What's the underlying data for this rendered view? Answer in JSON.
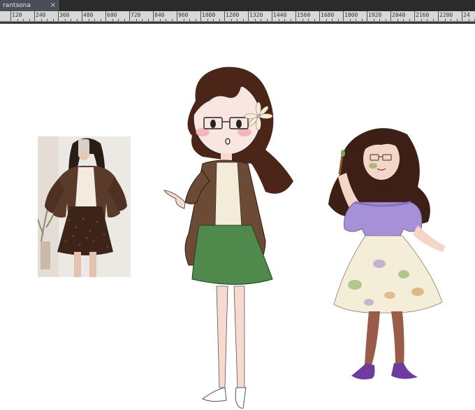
{
  "document_tab": {
    "title": "rantsona",
    "close_glyph": "×"
  },
  "ruler": {
    "labels": [
      "120",
      "240",
      "360",
      "480",
      "600",
      "720",
      "840",
      "960",
      "1080",
      "1200",
      "1320",
      "1440",
      "1560",
      "1680",
      "1800",
      "1920",
      "2040",
      "2160",
      "2280",
      "24"
    ]
  },
  "canvas": {
    "reference_photo": {
      "subject": "reference-outfit-photo",
      "colors": {
        "cardigan": "#5a3a28",
        "blouse": "#f2ece0",
        "skirt": "#3d2418",
        "hair": "#2a1d16"
      }
    },
    "sketch_character": {
      "colors": {
        "hair": "#4a2518",
        "cardigan": "#6b4a36",
        "blouse": "#f3ecd9",
        "skirt": "#4f8a4c",
        "skin": "#f7d9d0",
        "blush": "#f2a3a9"
      },
      "icons": [
        "flower-clip-icon",
        "glasses-icon"
      ]
    },
    "final_character": {
      "colors": {
        "hair": "#3e1f16",
        "top": "#a791d6",
        "skirt": "#f4eed9",
        "legs": "#9a5c48",
        "shoes": "#6d3c9e",
        "paint_green": "#7aa84e",
        "paint_orange": "#d08a4a",
        "paint_purple": "#9c7fc8"
      },
      "icons": [
        "paintbrush-icon",
        "glasses-icon"
      ]
    }
  }
}
